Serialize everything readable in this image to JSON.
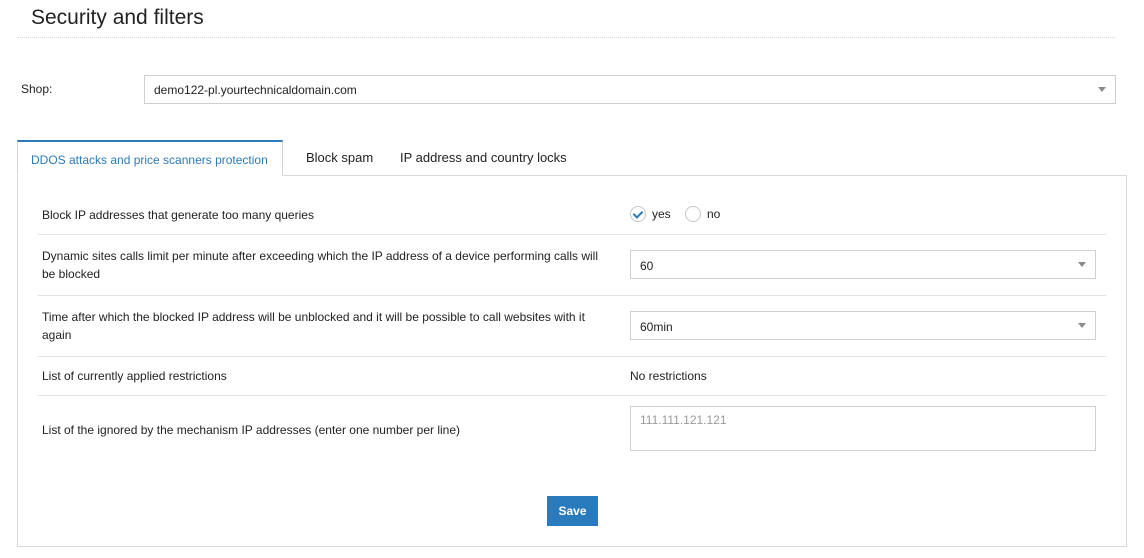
{
  "page": {
    "title": "Security and filters"
  },
  "shop": {
    "label": "Shop:",
    "selected": "demo122-pl.yourtechnicaldomain.com"
  },
  "tabs": [
    {
      "label": "DDOS attacks and price scanners protection",
      "active": true
    },
    {
      "label": "Block spam",
      "active": false
    },
    {
      "label": "IP address and country locks",
      "active": false
    }
  ],
  "form": {
    "block_ip": {
      "label": "Block IP addresses that generate too many queries",
      "options": [
        "yes",
        "no"
      ],
      "selected": "yes"
    },
    "calls_limit": {
      "label": "Dynamic sites calls limit per minute after exceeding which the IP address of a device performing calls will be blocked",
      "value": "60"
    },
    "unblock_time": {
      "label": "Time after which the blocked IP address will be unblocked and it will be possible to call websites with it again",
      "value": "60min"
    },
    "restrictions": {
      "label": "List of currently applied restrictions",
      "value": "No restrictions"
    },
    "ignored_ips": {
      "label": "List of the ignored by the mechanism IP addresses (enter one number per line)",
      "placeholder": "111.111.121.121"
    }
  },
  "save_label": "Save",
  "colors": {
    "accent": "#2a7bbd"
  }
}
